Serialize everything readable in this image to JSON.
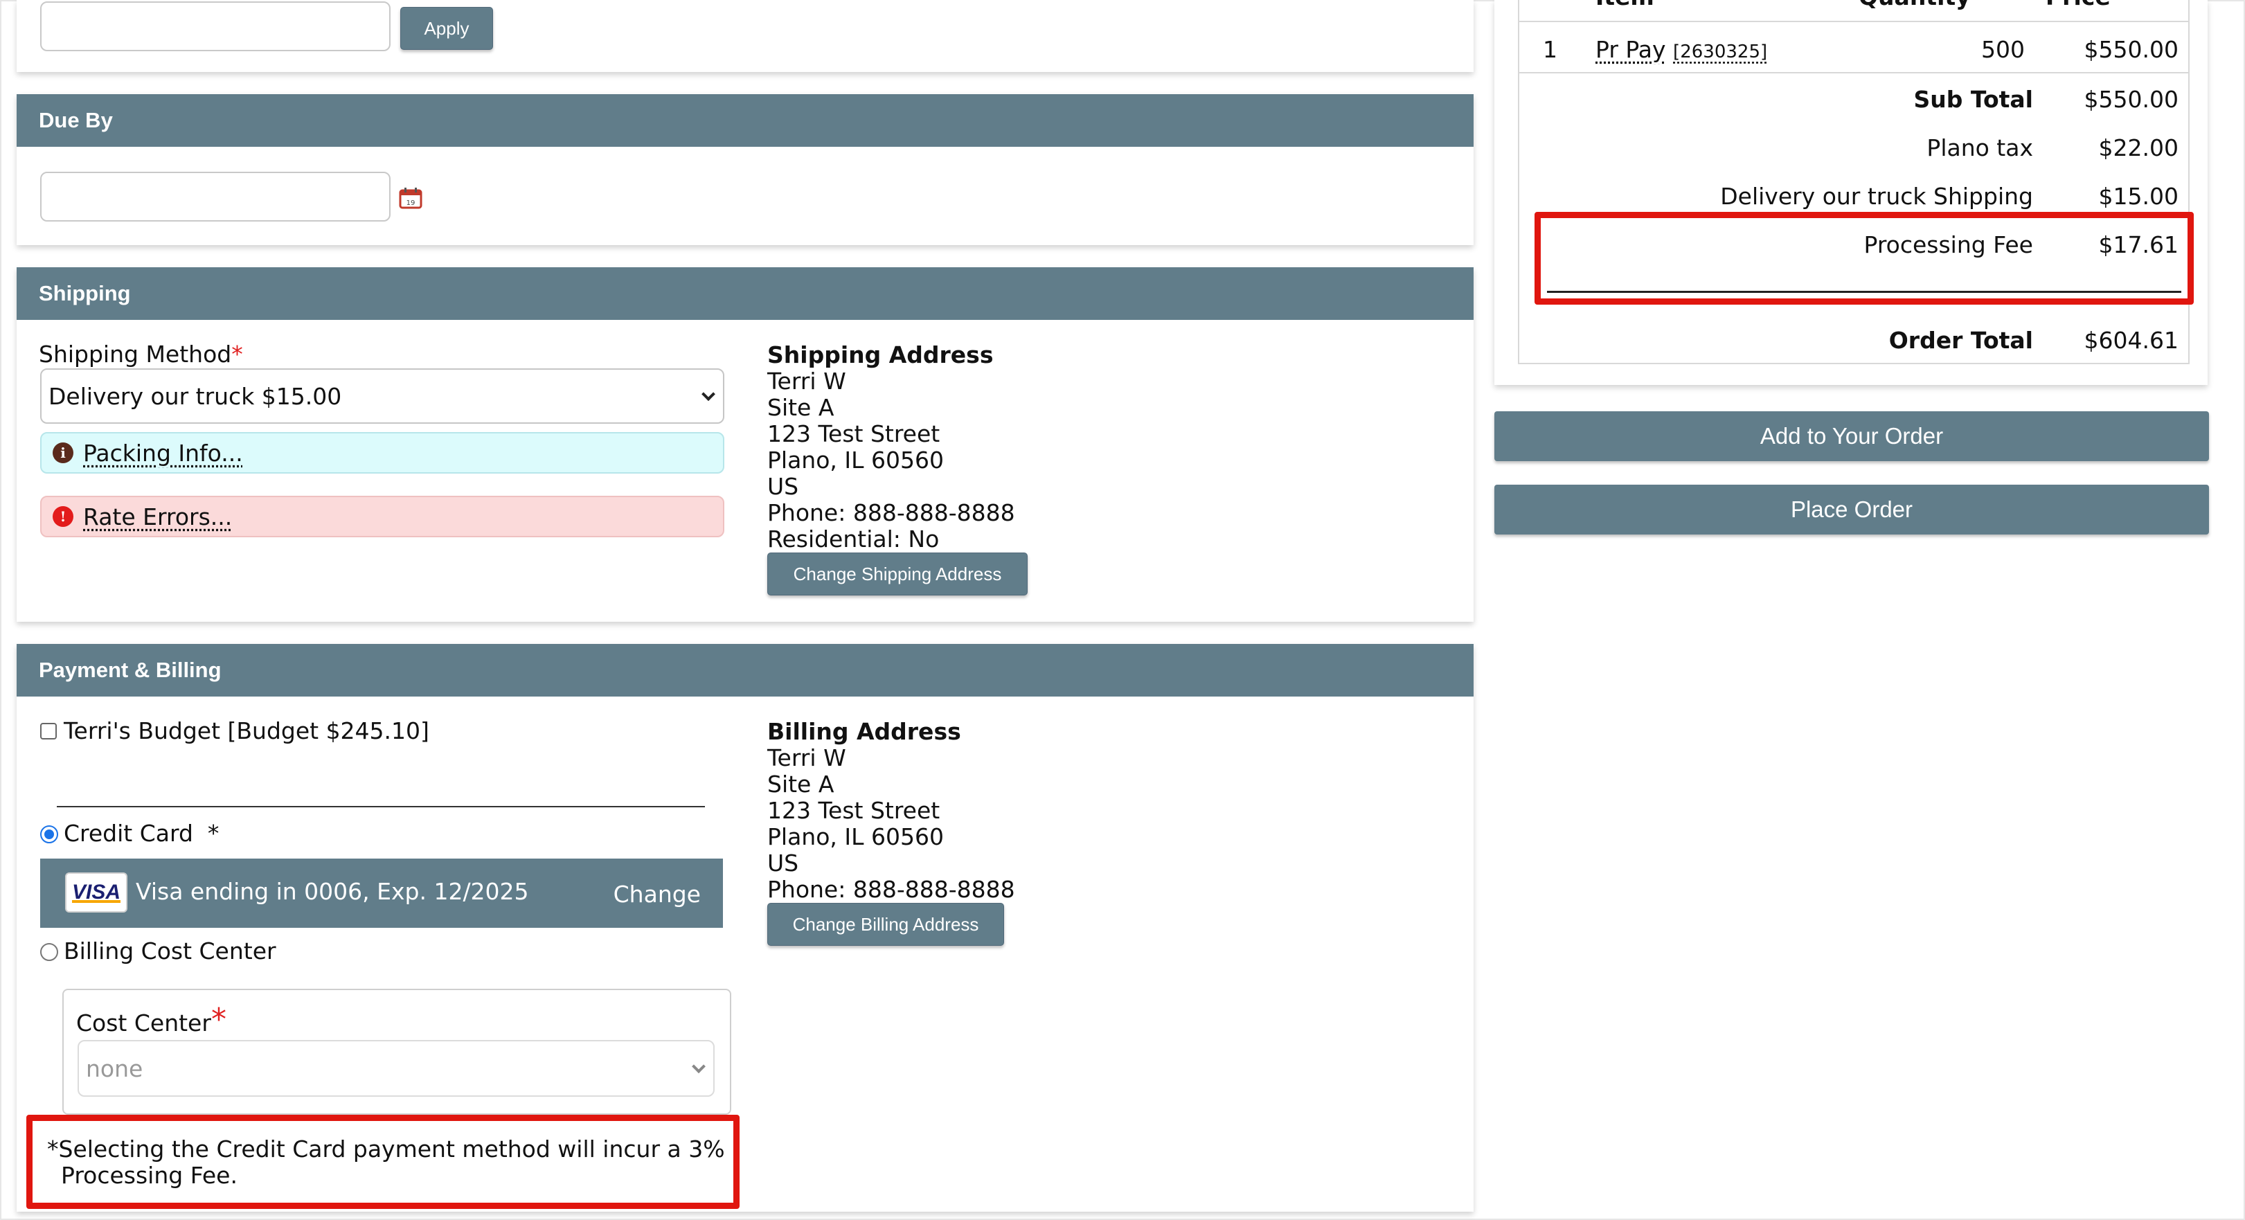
{
  "colors": {
    "header": "#617d8a",
    "accent_red": "#e0160f",
    "info_bg": "#dcfbfc",
    "error_bg": "#fbdada",
    "card_bar": "#617d8a"
  },
  "coupon": {
    "apply_label": "Apply"
  },
  "due_by": {
    "title": "Due By",
    "calendar_icon_text": "19"
  },
  "shipping": {
    "title": "Shipping",
    "method_label": "Shipping Method",
    "required_mark": "*",
    "method_value": "Delivery our truck $15.00",
    "packing_info": "Packing Info...",
    "rate_errors": "Rate Errors...",
    "address": {
      "title": "Shipping Address",
      "lines": [
        "Terri W",
        "Site A",
        "123 Test Street",
        "Plano, IL 60560",
        "US",
        "Phone: 888-888-8888",
        "Residential: No"
      ]
    },
    "change_button": "Change Shipping Address"
  },
  "payment": {
    "title": "Payment & Billing",
    "budget_label": "Terri's Budget [Budget $245.10]",
    "credit_card_label": "Credit Card  *",
    "card_brand": "VISA",
    "card_text": "Visa ending in 0006, Exp. 12/2025",
    "card_change": "Change",
    "cost_center_option": "Billing Cost Center",
    "cost_center_label": "Cost Center",
    "cost_center_required": "*",
    "cost_center_value": "none",
    "fee_notice_line1": "*Selecting the Credit Card payment method will incur a 3%",
    "fee_notice_line2": "Processing Fee.",
    "address": {
      "title": "Billing Address",
      "lines": [
        "Terri W",
        "Site A",
        "123 Test Street",
        "Plano, IL 60560",
        "US",
        "Phone: 888-888-8888"
      ]
    },
    "change_button": "Change Billing Address"
  },
  "summary": {
    "header_cells": [
      "Item",
      "Quantity",
      "Price"
    ],
    "item": {
      "number": "1",
      "name": "Pr Pay",
      "code": "[2630325]",
      "quantity": "500",
      "price": "$550.00"
    },
    "subtotal_label": "Sub Total",
    "subtotal_value": "$550.00",
    "tax_label": "Plano tax",
    "tax_value": "$22.00",
    "shipping_label": "Delivery our truck Shipping",
    "shipping_value": "$15.00",
    "fee_label": "Processing Fee",
    "fee_value": "$17.61",
    "total_label": "Order Total",
    "total_value": "$604.61"
  },
  "actions": {
    "add_to_order": "Add to Your Order",
    "place_order": "Place Order"
  }
}
